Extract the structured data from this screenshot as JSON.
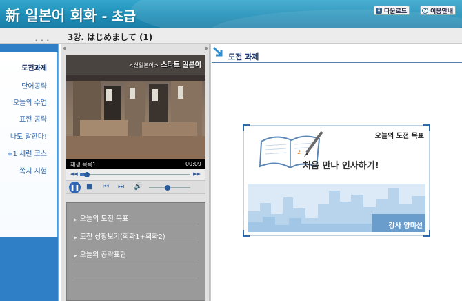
{
  "header": {
    "logo_main": "新 일본어 회화",
    "logo_sub": "- 초급",
    "download_label": "다운로드",
    "guide_label": "이용안내",
    "download_icon": "download-icon",
    "guide_icon": "question-icon",
    "accent_color": "#1f8fb8"
  },
  "titlebar": {
    "lesson": "3강. はじめまして (1)"
  },
  "sidebar": {
    "items": [
      {
        "label": "도전과제",
        "active": true
      },
      {
        "label": "단어공략"
      },
      {
        "label": "오늘의 수업"
      },
      {
        "label": "표현 공략"
      },
      {
        "label": "나도 말한다!"
      },
      {
        "label": "+1 세련 코스"
      },
      {
        "label": "쪽지 시험"
      }
    ]
  },
  "video": {
    "overlay_prefix": "<신일본어>",
    "overlay_title": "스타트 일본어",
    "playlist_label": "재생 목록1",
    "time": "00:09",
    "progress": 0.06,
    "volume": 0.45
  },
  "menu": {
    "items": [
      {
        "label": "오늘의 도전 목표"
      },
      {
        "label": "도전 상황보기(회화1+회화2)"
      },
      {
        "label": "오늘의 공략표현"
      }
    ]
  },
  "content": {
    "section_title": "도전 과제",
    "card": {
      "goal_title": "오늘의 도전 목표",
      "phrase": "처음 만나 인사하기!",
      "teacher": "강사 양미선"
    }
  }
}
